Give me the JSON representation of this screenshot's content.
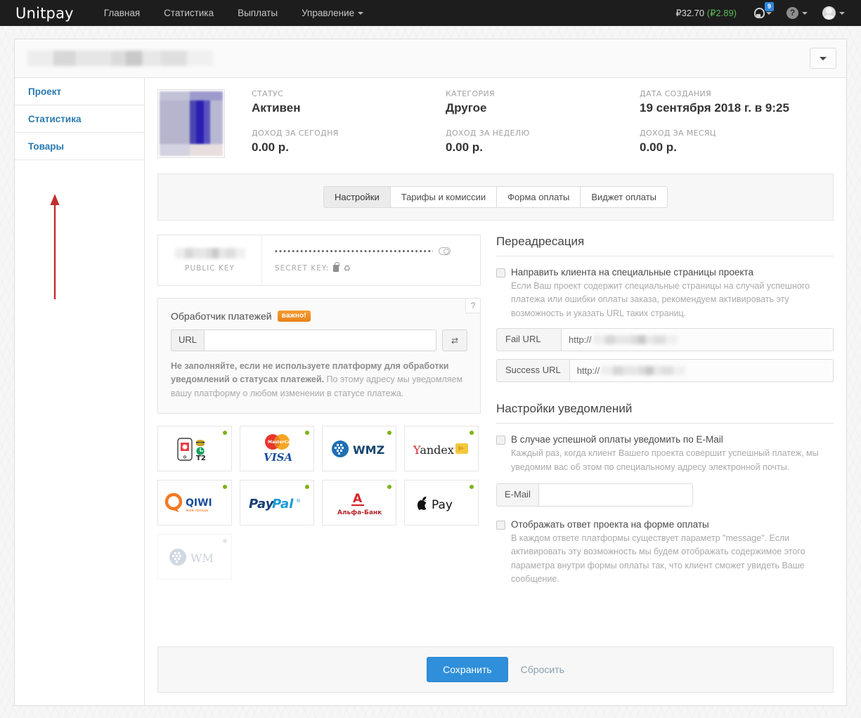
{
  "navbar": {
    "brand": "Unitpay",
    "links": [
      {
        "label": "Главная",
        "caret": false
      },
      {
        "label": "Статистика",
        "caret": false
      },
      {
        "label": "Выплаты",
        "caret": false
      },
      {
        "label": "Управление",
        "caret": true
      }
    ],
    "balance_main": "₽32.70",
    "balance_sub": "(₽2.89)",
    "notifications_badge": "9",
    "help_glyph": "?",
    "icons": [
      "bell-icon",
      "help-icon",
      "avatar-icon"
    ]
  },
  "frame": {
    "project_title_redacted": "",
    "collapse_icon": "chevron-down-icon"
  },
  "sidebar": {
    "items": [
      {
        "label": "Проект"
      },
      {
        "label": "Статистика"
      },
      {
        "label": "Товары"
      }
    ],
    "annotation": {
      "type": "red-arrow",
      "points_to": "Товары",
      "color": "#c0302b"
    }
  },
  "summary": {
    "cells": [
      {
        "label": "СТАТУС",
        "value": "Активен"
      },
      {
        "label": "КАТЕГОРИЯ",
        "value": "Другое"
      },
      {
        "label": "ДАТА СОЗДАНИЯ",
        "value": "19 сентября 2018 г. в 9:25"
      },
      {
        "label": "ДОХОД ЗА СЕГОДНЯ",
        "value": "0.00 р."
      },
      {
        "label": "ДОХОД ЗА НЕДЕЛЮ",
        "value": "0.00 р."
      },
      {
        "label": "ДОХОД ЗА МЕСЯЦ",
        "value": "0.00 р."
      }
    ]
  },
  "tabs": [
    {
      "label": "Настройки",
      "active": true
    },
    {
      "label": "Тарифы и комиссии",
      "active": false
    },
    {
      "label": "Форма оплаты",
      "active": false
    },
    {
      "label": "Виджет оплаты",
      "active": false
    }
  ],
  "keys": {
    "public_caption": "PUBLIC KEY",
    "public_value_redacted": "",
    "secret_dots": "••••••••••••••••••••••••••••••••••••••",
    "secret_caption": "SECRET KEY:",
    "secret_icons": [
      "lock-icon",
      "regenerate-icon"
    ],
    "visibility_toggle": "eye-toggle-icon"
  },
  "handler": {
    "help_glyph": "?",
    "title": "Обработчик платежей",
    "badge": "важно!",
    "url_addon": "URL",
    "url_value": "",
    "url_placeholder": "",
    "refresh_icon": "swap-icon",
    "note_bold": "Не заполняйте, если не используете платформу для обработки уведомлений о статусах платежей.",
    "note_rest": " По этому адресу мы уведомляем вашу платформу о любом изменении в статусе платежа."
  },
  "payment_methods": [
    {
      "name": "Tele2 / мобильный платёж",
      "short": "T2",
      "enabled": true
    },
    {
      "name": "MasterCard VISA",
      "short": "VISA",
      "enabled": true
    },
    {
      "name": "WMZ",
      "short": "WMZ",
      "enabled": true
    },
    {
      "name": "Yandex Деньги",
      "short": "Yandex",
      "enabled": true
    },
    {
      "name": "QIWI",
      "short": "QIWI",
      "sub": "won npouje",
      "enabled": true
    },
    {
      "name": "PayPal",
      "short": "PayPal",
      "enabled": true
    },
    {
      "name": "Альфа-Банк",
      "short": "А",
      "sub": "Альфа-Банк",
      "enabled": true
    },
    {
      "name": "Apple Pay",
      "short": "Pay",
      "enabled": true
    },
    {
      "name": "WebMoney WM",
      "short": "WM",
      "enabled": false
    }
  ],
  "redirect": {
    "title": "Переадресация",
    "checkbox_label": "Направить клиента на специальные страницы проекта",
    "checked": false,
    "description": "Если Ваш проект содержит специальные страницы на случай успешного платежа или ошибки оплаты заказа, рекомендуем активировать эту возможность и указать URL таких страниц.",
    "fields": [
      {
        "label": "Fail URL",
        "prefix": "http://",
        "value_redacted": ""
      },
      {
        "label": "Success URL",
        "prefix": "http://",
        "value_redacted": ""
      }
    ]
  },
  "notifications": {
    "title": "Настройки уведомлений",
    "email_checkbox_label": "В случае успешной оплаты уведомить по E-Mail",
    "email_checked": false,
    "email_description": "Каждый раз, когда клиент Вашего проекта совершит успешный платеж, мы уведомим вас об этом по специальному адресу электронной почты.",
    "email_addon": "E-Mail",
    "email_value": "",
    "email_placeholder": "",
    "message_checkbox_label": "Отображать ответ проекта на форме оплаты",
    "message_checked": false,
    "message_description": "В каждом ответе платформы существует параметр \"message\". Если активировать эту возможность мы будем отображать содержимое этого параметра внутри формы оплаты так, что клиент сможет увидеть Ваше сообщение."
  },
  "footer": {
    "save_label": "Сохранить",
    "reset_label": "Сбросить"
  },
  "colors": {
    "navbar_bg": "#1d1d1d",
    "link_blue": "#2a7ab0",
    "primary_button": "#2f8fdb",
    "badge_orange": "#e8821a",
    "status_green": "#7ab317",
    "annotation_red": "#c0302b",
    "balance_green": "#5cb85c"
  }
}
